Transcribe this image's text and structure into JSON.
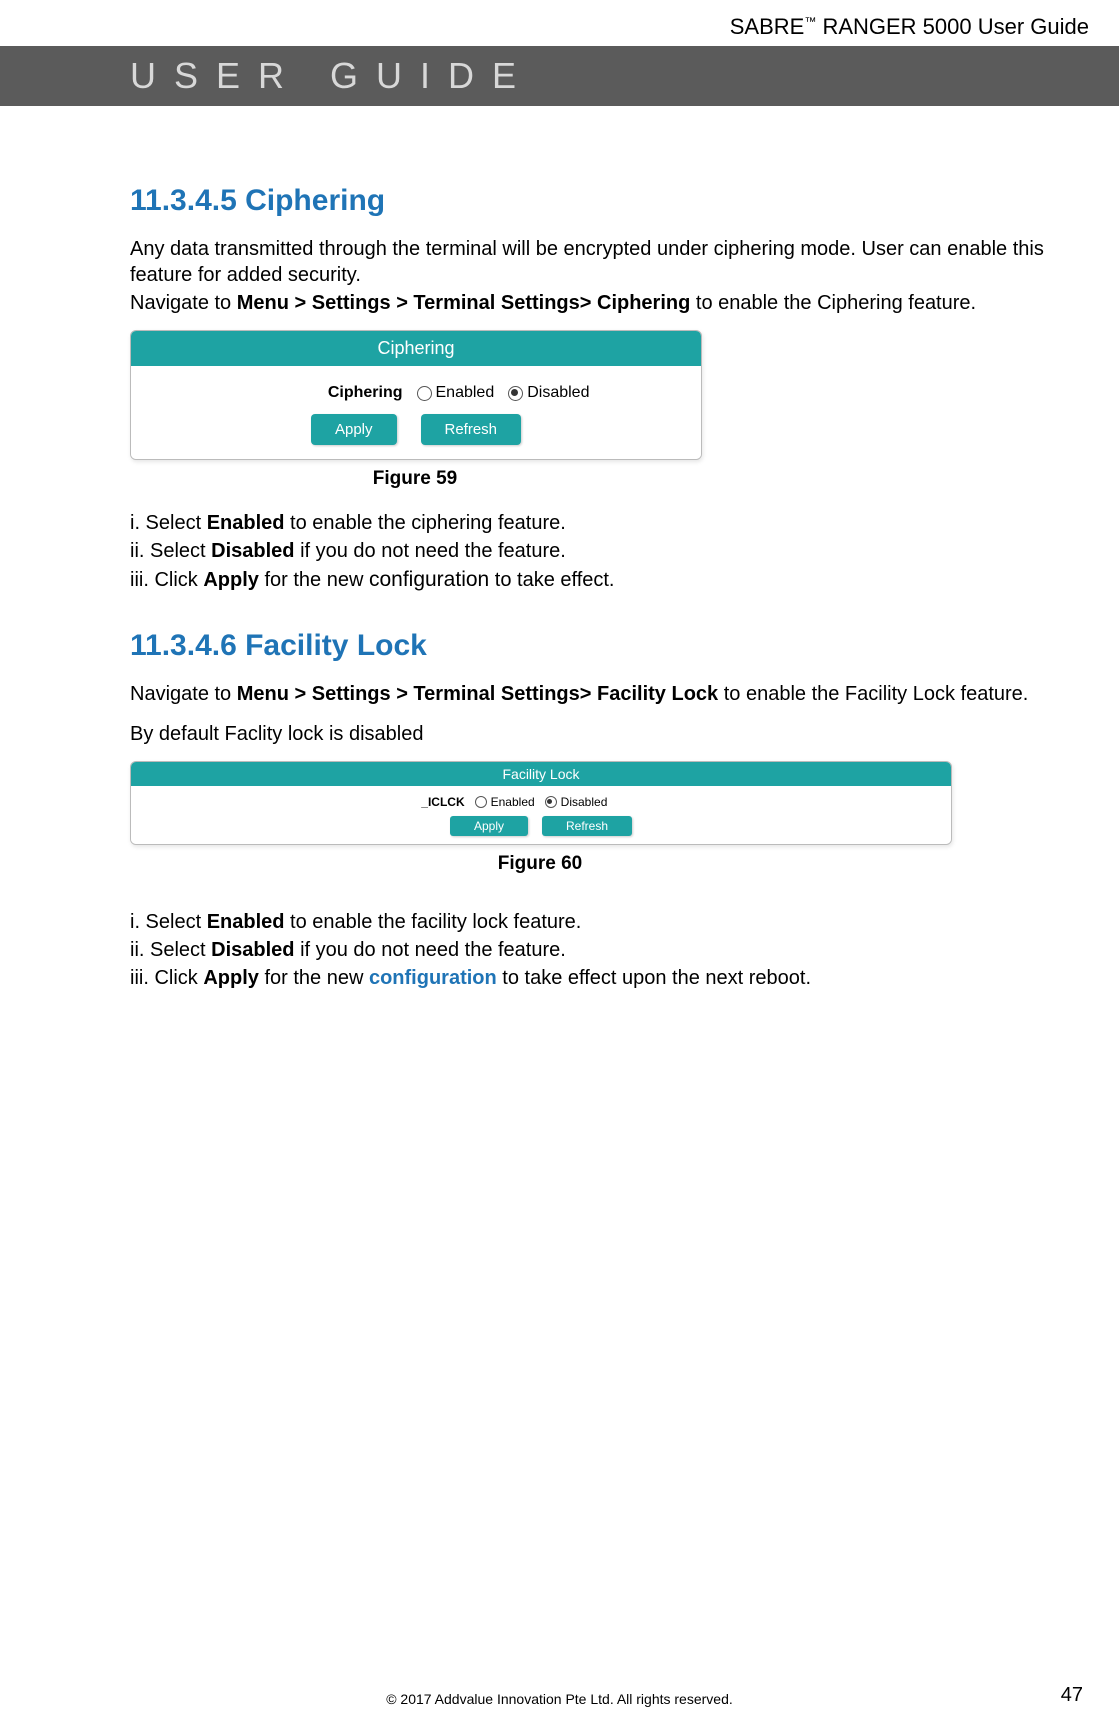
{
  "header": {
    "product_pre": "SABRE",
    "product_tm": "™",
    "product_post": " RANGER 5000 User Guide",
    "banner": "USER GUIDE"
  },
  "section1": {
    "heading": "11.3.4.5 Ciphering",
    "para1a": "Any data transmitted through the terminal will be encrypted under ciphering mode. User can enable this feature for added security.",
    "para1b_pre": "Navigate to ",
    "para1b_bold": "Menu > Settings > Terminal Settings> Ciphering",
    "para1b_post": " to enable the Ciphering feature.",
    "figure": {
      "title": "Ciphering",
      "row_label": "Ciphering",
      "opt_enabled": "Enabled",
      "opt_disabled": "Disabled",
      "btn_apply": "Apply",
      "btn_refresh": "Refresh",
      "caption": "Figure 59"
    },
    "steps": {
      "i_pre": "i. Select ",
      "i_bold": "Enabled",
      "i_post": " to enable the ciphering feature.",
      "ii_pre": "ii. Select ",
      "ii_bold": "Disabled",
      "ii_post": " if you do not need the feature.",
      "iii_pre": "iii. Click ",
      "iii_bold": "Apply",
      "iii_mid": " for the new ",
      "iii_cfg": "configuration",
      "iii_post": " to take effect."
    }
  },
  "section2": {
    "heading": "11.3.4.6 Facility Lock",
    "para1_pre": "Navigate to ",
    "para1_bold": "Menu > Settings > Terminal Settings> Facility Lock",
    "para1_post": " to enable the Facility Lock feature.",
    "para2": "By default Faclity lock is disabled",
    "figure": {
      "title": "Facility Lock",
      "row_label": "_ICLCK",
      "opt_enabled": "Enabled",
      "opt_disabled": "Disabled",
      "btn_apply": "Apply",
      "btn_refresh": "Refresh",
      "caption": "Figure 60"
    },
    "steps": {
      "i_pre": "i. Select ",
      "i_bold": "Enabled",
      "i_post": " to enable the facility lock feature.",
      "ii_pre": "ii. Select ",
      "ii_bold": "Disabled",
      "ii_post": " if you do not need the feature.",
      "iii_pre": "iii. Click ",
      "iii_bold": "Apply",
      "iii_mid": " for the new ",
      "iii_cfg": "configuration",
      "iii_post": " to take effect upon the next reboot."
    }
  },
  "footer": {
    "copyright": "© 2017 Addvalue Innovation Pte Ltd. All rights reserved.",
    "page": "47"
  }
}
